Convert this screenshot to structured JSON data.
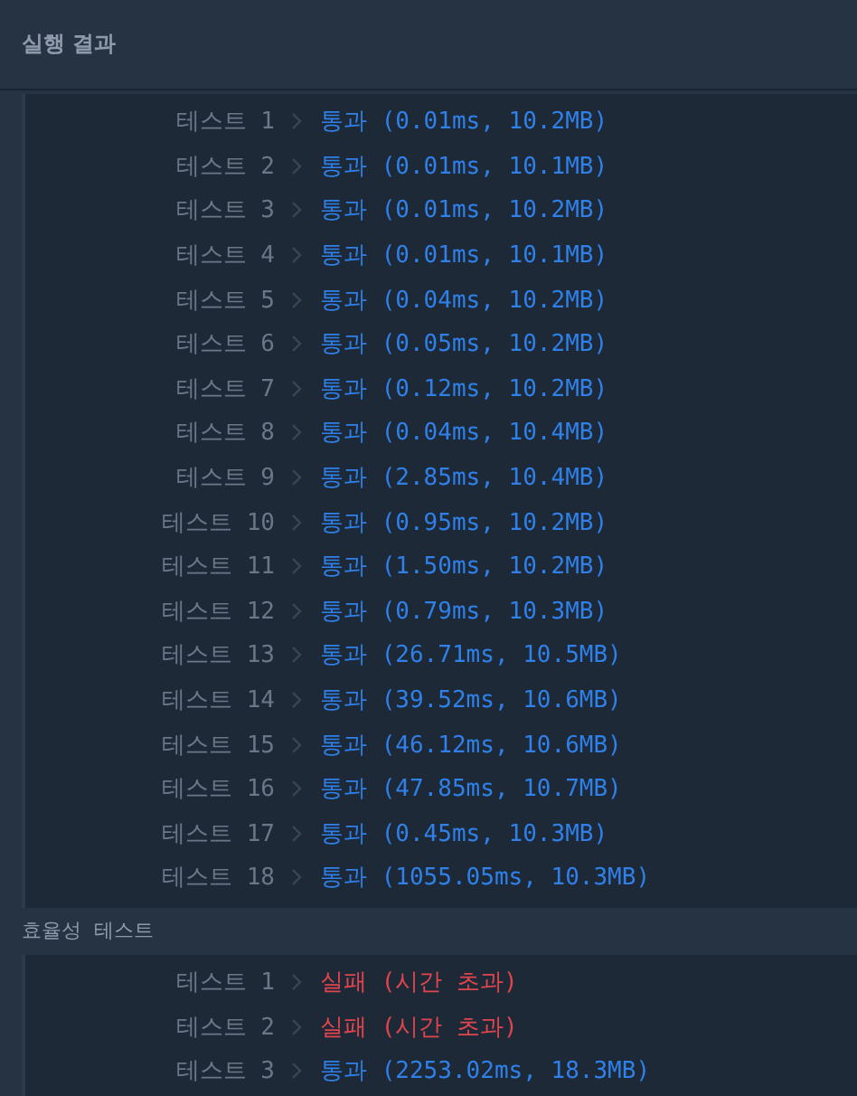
{
  "header": {
    "title": "실행 결과"
  },
  "sections": [
    {
      "tests": [
        {
          "label": "테스트 1",
          "kind": "pass",
          "result": "통과 (0.01ms, 10.2MB)"
        },
        {
          "label": "테스트 2",
          "kind": "pass",
          "result": "통과 (0.01ms, 10.1MB)"
        },
        {
          "label": "테스트 3",
          "kind": "pass",
          "result": "통과 (0.01ms, 10.2MB)"
        },
        {
          "label": "테스트 4",
          "kind": "pass",
          "result": "통과 (0.01ms, 10.1MB)"
        },
        {
          "label": "테스트 5",
          "kind": "pass",
          "result": "통과 (0.04ms, 10.2MB)"
        },
        {
          "label": "테스트 6",
          "kind": "pass",
          "result": "통과 (0.05ms, 10.2MB)"
        },
        {
          "label": "테스트 7",
          "kind": "pass",
          "result": "통과 (0.12ms, 10.2MB)"
        },
        {
          "label": "테스트 8",
          "kind": "pass",
          "result": "통과 (0.04ms, 10.4MB)"
        },
        {
          "label": "테스트 9",
          "kind": "pass",
          "result": "통과 (2.85ms, 10.4MB)"
        },
        {
          "label": "테스트 10",
          "kind": "pass",
          "result": "통과 (0.95ms, 10.2MB)"
        },
        {
          "label": "테스트 11",
          "kind": "pass",
          "result": "통과 (1.50ms, 10.2MB)"
        },
        {
          "label": "테스트 12",
          "kind": "pass",
          "result": "통과 (0.79ms, 10.3MB)"
        },
        {
          "label": "테스트 13",
          "kind": "pass",
          "result": "통과 (26.71ms, 10.5MB)"
        },
        {
          "label": "테스트 14",
          "kind": "pass",
          "result": "통과 (39.52ms, 10.6MB)"
        },
        {
          "label": "테스트 15",
          "kind": "pass",
          "result": "통과 (46.12ms, 10.6MB)"
        },
        {
          "label": "테스트 16",
          "kind": "pass",
          "result": "통과 (47.85ms, 10.7MB)"
        },
        {
          "label": "테스트 17",
          "kind": "pass",
          "result": "통과 (0.45ms, 10.3MB)"
        },
        {
          "label": "테스트 18",
          "kind": "pass",
          "result": "통과 (1055.05ms, 10.3MB)"
        }
      ]
    },
    {
      "title": "효율성  테스트",
      "tests": [
        {
          "label": "테스트 1",
          "kind": "fail",
          "result": "실패 (시간 초과)"
        },
        {
          "label": "테스트 2",
          "kind": "fail",
          "result": "실패 (시간 초과)"
        },
        {
          "label": "테스트 3",
          "kind": "pass",
          "result": "통과 (2253.02ms, 18.3MB)"
        }
      ]
    }
  ]
}
